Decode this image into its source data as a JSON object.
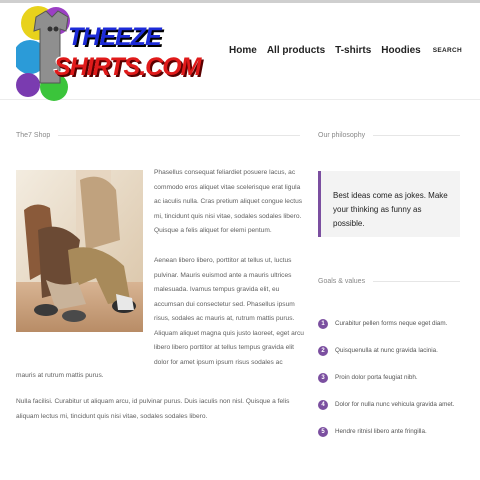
{
  "brand": {
    "logo_line1": "THEEZE",
    "logo_line2": "SHIRTS.COM",
    "colors": {
      "blue": "#1d2bd8",
      "red": "#e01a1a",
      "accent": "#7b4fa0"
    }
  },
  "nav": {
    "items": [
      "Home",
      "All products",
      "T-shirts",
      "Hoodies"
    ],
    "search_label": "SEARCH"
  },
  "shop": {
    "title": "The7 Shop",
    "photo_icon": "couple-photo",
    "para1": "Phasellus consequat feliardiet posuere lacus, ac commodo eros aliquet vitae scelerisque erat ligula ac iaculis nulla. Cras pretium aliquet congue lectus mi, tincidunt quis nisi vitae, sodales sodales libero. Quisque a felis aliquet for elemi pentum.",
    "para2": "Aenean libero libero, porttitor at tellus ut, luctus pulvinar. Mauris euismod ante a mauris ultrices malesuada. Ivamus tempus gravida elit, eu accumsan dui consectetur sed. Phasellus ipsum risus, sodales ac mauris at, rutrum mattis purus. Aliquam aliquet magna quis justo laoreet, eget arcu libero libero porttitor at tellus tempus gravida elit dolor for amet ipsum ipsum risus sodales ac mauris at rutrum mattis purus.",
    "para3": "Nulla facilisi. Curabitur ut aliquam arcu, id pulvinar purus. Duis iaculis non nisl. Quisque a felis aliquam lectus mi, tincidunt quis nisi vitae, sodales sodales libero."
  },
  "philosophy": {
    "title": "Our philosophy",
    "quote": "Best ideas come as jokes. Make your thinking as funny as possible."
  },
  "goals": {
    "title": "Goals & values",
    "items": [
      {
        "num": "1",
        "text": "Curabitur pellen forms neque eget diam."
      },
      {
        "num": "2",
        "text": "Quisquenulla at nunc gravida lacinia."
      },
      {
        "num": "3",
        "text": "Proin dolor porta feugiat nibh."
      },
      {
        "num": "4",
        "text": "Dolor for nulla nunc vehicula gravida amet."
      },
      {
        "num": "5",
        "text": "Hendre ritnisl libero ante fringilla."
      }
    ]
  }
}
